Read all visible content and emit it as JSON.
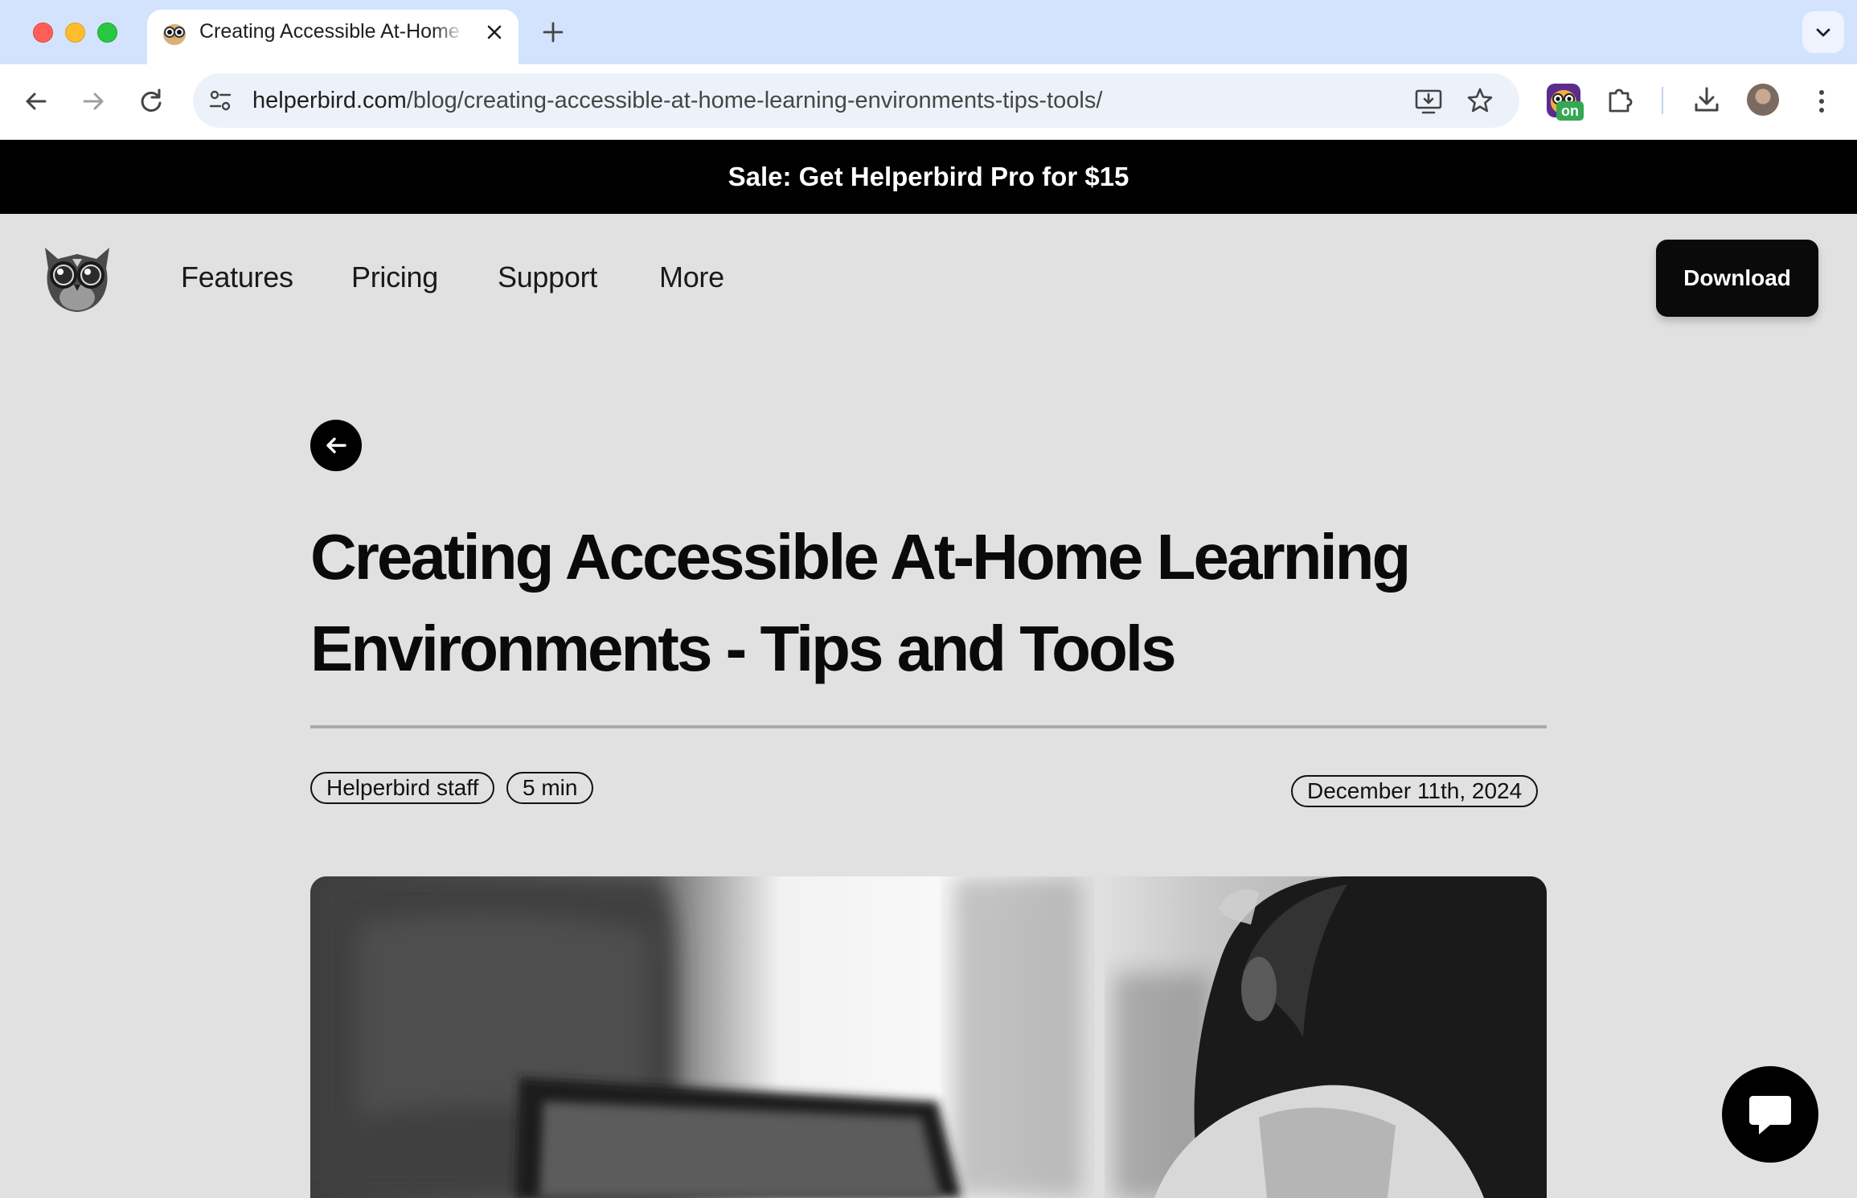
{
  "browser": {
    "tab": {
      "title": "Creating Accessible At-Home Learning Environments - Tips and Tools"
    },
    "address_bar": {
      "host": "helperbird.com",
      "path": "/blog/creating-accessible-at-home-learning-environments-tips-tools/"
    },
    "extension_badge": "on"
  },
  "page": {
    "sale_banner": "Sale: Get Helperbird Pro for $15",
    "nav": {
      "links": [
        "Features",
        "Pricing",
        "Support",
        "More"
      ],
      "download_label": "Download"
    },
    "article": {
      "title_line1": "Creating Accessible At-Home Learning",
      "title_line2": "Environments - Tips and Tools",
      "author": "Helperbird staff",
      "read_time": "5 min",
      "date": "December 11th, 2024"
    }
  },
  "colors": {
    "page_background": "#e1e1e1",
    "banner_background": "#000000",
    "tabbar_background": "#d3e3fd",
    "omnibox_background": "#edf2fa",
    "extension_badge": "#34a853"
  },
  "icons": [
    "owl-favicon-icon",
    "close-icon",
    "plus-icon",
    "chevron-down-icon",
    "back-arrow-icon",
    "forward-arrow-icon",
    "reload-icon",
    "site-info-icon",
    "install-app-icon",
    "star-icon",
    "extension-owl-icon",
    "puzzle-icon",
    "download-icon",
    "kebab-menu-icon",
    "owl-logo-icon",
    "arrow-left-icon",
    "chat-icon"
  ]
}
